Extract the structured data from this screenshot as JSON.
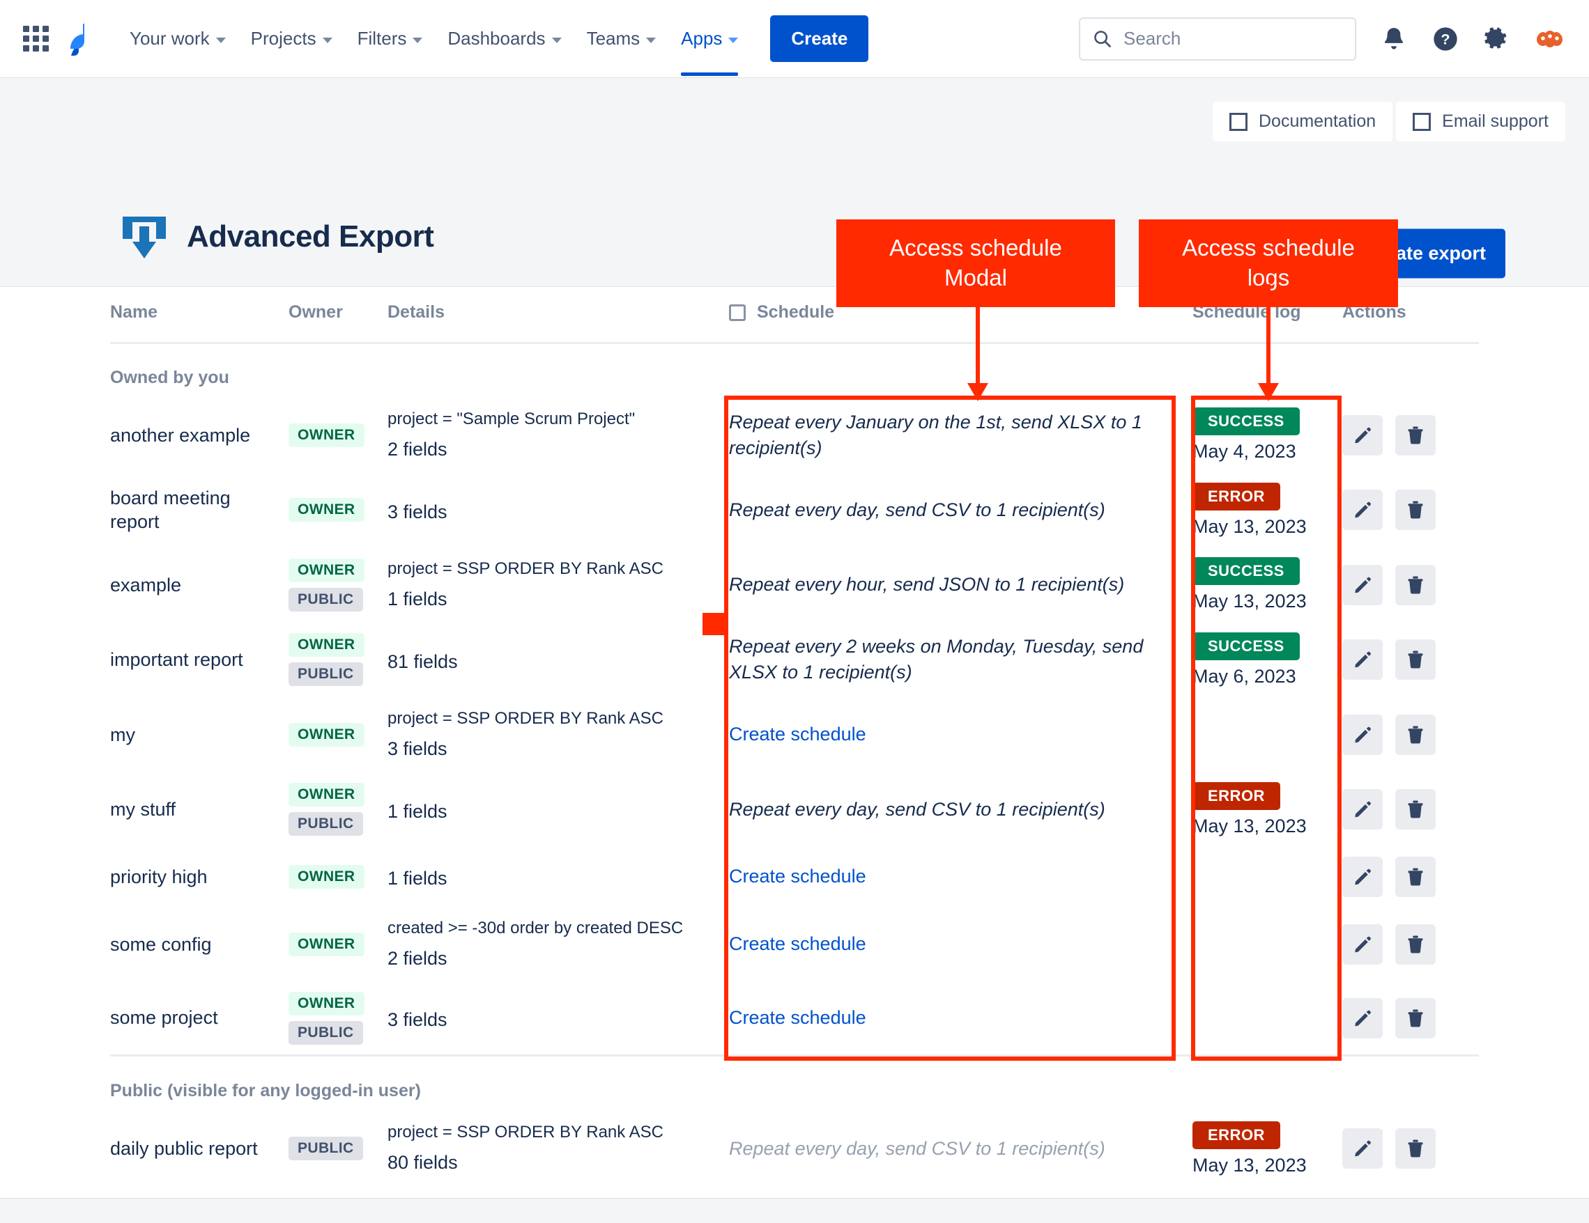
{
  "nav": {
    "app_switcher_icon": "grid-apps-icon",
    "logo_icon": "jira-logo-icon",
    "items": [
      {
        "label": "Your work",
        "has_chevron": true,
        "active": false
      },
      {
        "label": "Projects",
        "has_chevron": true,
        "active": false
      },
      {
        "label": "Filters",
        "has_chevron": true,
        "active": false
      },
      {
        "label": "Dashboards",
        "has_chevron": true,
        "active": false
      },
      {
        "label": "Teams",
        "has_chevron": true,
        "active": false
      },
      {
        "label": "Apps",
        "has_chevron": true,
        "active": true
      }
    ],
    "create_label": "Create",
    "search": {
      "placeholder": "Search",
      "value": "",
      "icon": "search-icon"
    },
    "right_icons": [
      "notification-bell-icon",
      "help-question-icon",
      "settings-gear-icon",
      "user-avatar-icon"
    ],
    "accent_color": "#0052CC"
  },
  "app_header": {
    "help_buttons": [
      {
        "label": "Documentation",
        "icon": "square-outline-icon"
      },
      {
        "label": "Email support",
        "icon": "square-outline-icon"
      }
    ],
    "logo_icon": "export-download-icon",
    "title": "Advanced Export",
    "create_export_label": "Create export"
  },
  "table": {
    "columns": [
      "Name",
      "Owner",
      "Details",
      "Schedule",
      "Schedule log",
      "Actions"
    ],
    "schedule_header_checkbox": {
      "checked": false,
      "icon": "checkbox-unchecked-icon"
    },
    "groups": [
      {
        "label": "Owned by you",
        "rows": [
          {
            "name": "another example",
            "badges": [
              {
                "text": "OWNER",
                "kind": "owner"
              }
            ],
            "jql": "project = \"Sample Scrum Project\"",
            "fields": "2 fields",
            "schedule": {
              "text": "Repeat every January on the 1st, send XLSX to 1 recipient(s)",
              "is_link": false,
              "muted": false
            },
            "log": {
              "status": "SUCCESS",
              "kind": "success",
              "date": "May 4, 2023"
            },
            "actions": [
              "edit-pencil-icon",
              "delete-trash-icon"
            ]
          },
          {
            "name": "board meeting report",
            "badges": [
              {
                "text": "OWNER",
                "kind": "owner"
              }
            ],
            "jql": "",
            "fields": "3 fields",
            "schedule": {
              "text": "Repeat every day, send CSV to 1 recipient(s)",
              "is_link": false,
              "muted": false
            },
            "log": {
              "status": "ERROR",
              "kind": "error",
              "date": "May 13, 2023"
            },
            "actions": [
              "edit-pencil-icon",
              "delete-trash-icon"
            ]
          },
          {
            "name": "example",
            "badges": [
              {
                "text": "OWNER",
                "kind": "owner"
              },
              {
                "text": "PUBLIC",
                "kind": "public"
              }
            ],
            "jql": "project = SSP ORDER BY Rank ASC",
            "fields": "1 fields",
            "schedule": {
              "text": "Repeat every hour, send JSON to 1 recipient(s)",
              "is_link": false,
              "muted": false
            },
            "log": {
              "status": "SUCCESS",
              "kind": "success",
              "date": "May 13, 2023"
            },
            "actions": [
              "edit-pencil-icon",
              "delete-trash-icon"
            ]
          },
          {
            "name": "important report",
            "badges": [
              {
                "text": "OWNER",
                "kind": "owner"
              },
              {
                "text": "PUBLIC",
                "kind": "public"
              }
            ],
            "jql": "",
            "fields": "81 fields",
            "schedule": {
              "text": "Repeat every 2 weeks on Monday, Tuesday, send XLSX to 1 recipient(s)",
              "is_link": false,
              "muted": false
            },
            "log": {
              "status": "SUCCESS",
              "kind": "success",
              "date": "May 6, 2023"
            },
            "actions": [
              "edit-pencil-icon",
              "delete-trash-icon"
            ]
          },
          {
            "name": "my",
            "badges": [
              {
                "text": "OWNER",
                "kind": "owner"
              }
            ],
            "jql": "project = SSP ORDER BY Rank ASC",
            "fields": "3 fields",
            "schedule": {
              "text": "Create schedule",
              "is_link": true,
              "muted": false
            },
            "log": null,
            "actions": [
              "edit-pencil-icon",
              "delete-trash-icon"
            ]
          },
          {
            "name": "my stuff",
            "badges": [
              {
                "text": "OWNER",
                "kind": "owner"
              },
              {
                "text": "PUBLIC",
                "kind": "public"
              }
            ],
            "jql": "",
            "fields": "1 fields",
            "schedule": {
              "text": "Repeat every day, send CSV to 1 recipient(s)",
              "is_link": false,
              "muted": false
            },
            "log": {
              "status": "ERROR",
              "kind": "error",
              "date": "May 13, 2023"
            },
            "actions": [
              "edit-pencil-icon",
              "delete-trash-icon"
            ]
          },
          {
            "name": "priority high",
            "badges": [
              {
                "text": "OWNER",
                "kind": "owner"
              }
            ],
            "jql": "",
            "fields": "1 fields",
            "schedule": {
              "text": "Create schedule",
              "is_link": true,
              "muted": false
            },
            "log": null,
            "actions": [
              "edit-pencil-icon",
              "delete-trash-icon"
            ]
          },
          {
            "name": "some config",
            "badges": [
              {
                "text": "OWNER",
                "kind": "owner"
              }
            ],
            "jql": "created >= -30d order by created DESC",
            "fields": "2 fields",
            "schedule": {
              "text": "Create schedule",
              "is_link": true,
              "muted": false
            },
            "log": null,
            "actions": [
              "edit-pencil-icon",
              "delete-trash-icon"
            ]
          },
          {
            "name": "some project",
            "badges": [
              {
                "text": "OWNER",
                "kind": "owner"
              },
              {
                "text": "PUBLIC",
                "kind": "public"
              }
            ],
            "jql": "",
            "fields": "3 fields",
            "schedule": {
              "text": "Create schedule",
              "is_link": true,
              "muted": false
            },
            "log": null,
            "actions": [
              "edit-pencil-icon",
              "delete-trash-icon"
            ]
          }
        ]
      },
      {
        "label": "Public (visible for any logged-in user)",
        "rows": [
          {
            "name": "daily public report",
            "badges": [
              {
                "text": "PUBLIC",
                "kind": "public"
              }
            ],
            "jql": "project = SSP ORDER BY Rank ASC",
            "fields": "80 fields",
            "schedule": {
              "text": "Repeat every day, send CSV to 1 recipient(s)",
              "is_link": false,
              "muted": true
            },
            "log": {
              "status": "ERROR",
              "kind": "error",
              "date": "May 13, 2023"
            },
            "actions": [
              "edit-pencil-icon",
              "delete-trash-icon"
            ]
          }
        ]
      }
    ]
  },
  "annotations": [
    {
      "id": "anno-modal",
      "text": "Access schedule Modal",
      "line1": "Access schedule",
      "line2": "Modal",
      "color": "#FF2A00"
    },
    {
      "id": "anno-logs",
      "text": "Access schedule logs",
      "line1": "Access schedule",
      "line2": "logs",
      "color": "#FF2A00"
    }
  ],
  "status_colors": {
    "success": "#00875A",
    "error": "#BF2600",
    "owner_badge": "#E3FCEF",
    "public_badge": "#DFE1E6",
    "annotation": "#FF2A00"
  }
}
